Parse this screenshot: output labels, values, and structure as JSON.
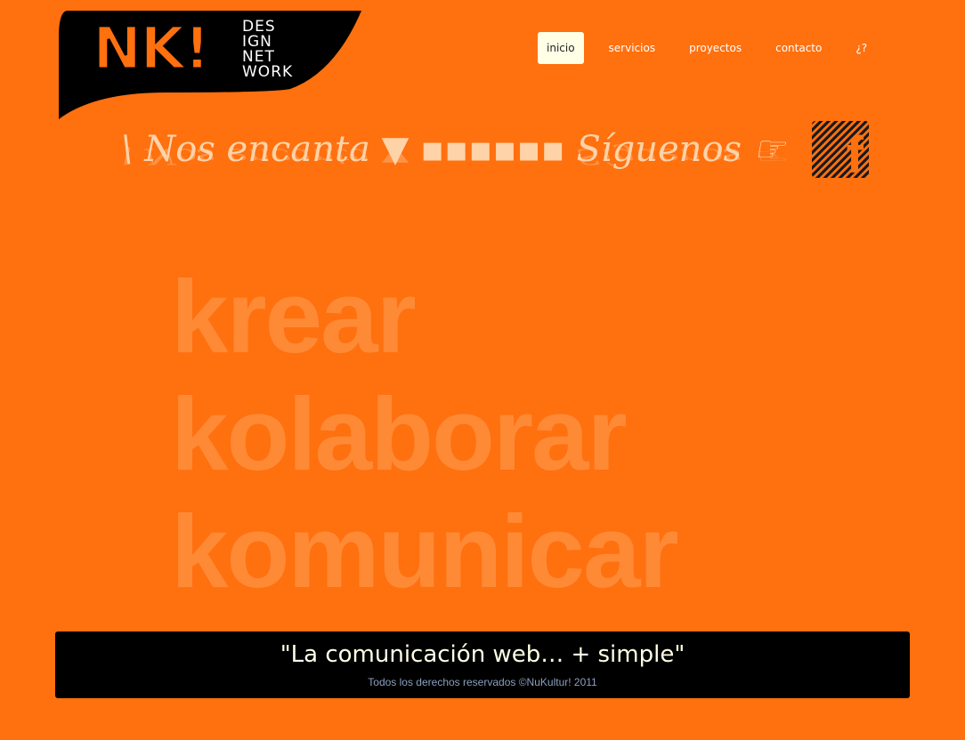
{
  "logo": {
    "mark": "NK!",
    "words": [
      "DES",
      "IGN",
      "NET",
      "WORK"
    ]
  },
  "nav": {
    "items": [
      {
        "label": "inicio",
        "active": true
      },
      {
        "label": "servicios",
        "active": false
      },
      {
        "label": "proyectos",
        "active": false
      },
      {
        "label": "contacto",
        "active": false
      },
      {
        "label": "¿?",
        "active": false
      }
    ]
  },
  "banner": {
    "text": "\\ Nos encanta ▼ ▪▪▪▪▪▪ Síguenos ☞",
    "social_icon": "facebook-icon",
    "social_letter": "f"
  },
  "hero": {
    "words": [
      "krear",
      "kolaborar",
      "komunicar"
    ]
  },
  "footer": {
    "slogan": "\"La comunicación web… + simple\"",
    "copyright": "Todos los derechos reservados ©NuKultur! 2011"
  },
  "colors": {
    "background": "#ff700f",
    "footer_bg": "#000000",
    "active_nav_bg": "#ffffe6"
  }
}
